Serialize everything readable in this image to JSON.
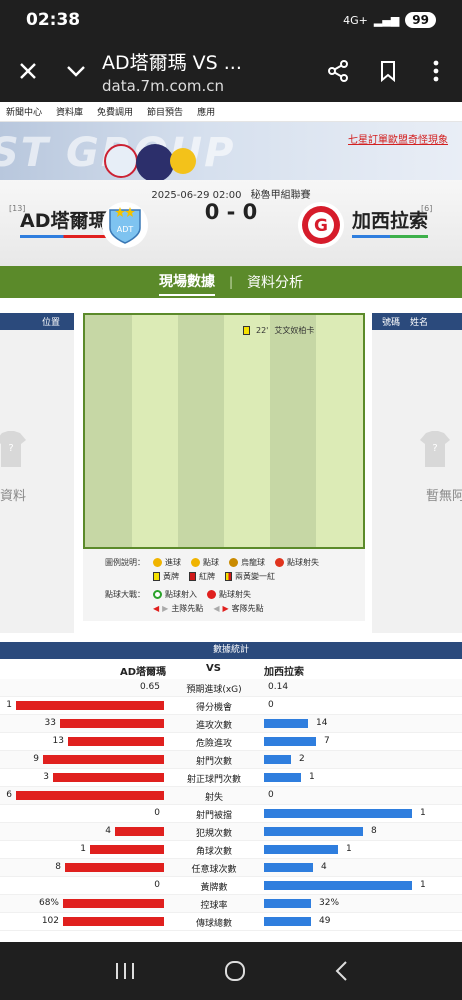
{
  "status_bar": {
    "time": "02:38",
    "network": "4G+",
    "battery": "99"
  },
  "browser": {
    "title": "AD塔爾瑪 VS ...",
    "url": "data.7m.com.cn"
  },
  "site_nav": [
    "新聞中心",
    "資料庫",
    "免費調用",
    "節目預告",
    "應用"
  ],
  "banner": {
    "text": "ST GROUP",
    "link": "七星訂單歐盟奇怪現象"
  },
  "match": {
    "datetime": "2025-06-29 02:00",
    "league": "秘魯甲組聯賽",
    "score": "0 - 0",
    "home": {
      "name": "AD塔爾瑪",
      "rank": "[13]"
    },
    "away": {
      "name": "加西拉索",
      "rank": "[6]"
    }
  },
  "tabs": [
    "現場數據",
    "資料分析"
  ],
  "side": {
    "left_header": "位置",
    "right_header_no": "號碼",
    "right_header_name": "姓名",
    "left_nodata": "資料",
    "right_nodata": "暫無阿"
  },
  "pitch_event": {
    "minute": "22'",
    "player": "艾文奴柏卡"
  },
  "legend": {
    "label": "圖例說明：",
    "items": [
      "進球",
      "點球",
      "烏龍球",
      "點球射失"
    ],
    "cards": [
      "黃牌",
      "紅牌",
      "兩黃變一紅"
    ],
    "shootout_label": "點球大戰：",
    "shootout": [
      "點球射入",
      "點球射失"
    ],
    "arrows": [
      "主隊先點",
      "客隊先點"
    ]
  },
  "stats": {
    "title": "數據統計",
    "home": "AD塔爾瑪",
    "vs": "VS",
    "away": "加西拉索",
    "rows": [
      {
        "label": "預期進球(xG)",
        "home": "0.65",
        "away": "0.14",
        "hf": 0,
        "af": 0
      },
      {
        "label": "得分機會",
        "home": "1",
        "away": "0",
        "hf": 1,
        "af": 0
      },
      {
        "label": "進攻次數",
        "home": "33",
        "away": "14",
        "hf": 0.7,
        "af": 0.3
      },
      {
        "label": "危險進攻",
        "home": "13",
        "away": "7",
        "hf": 0.65,
        "af": 0.35
      },
      {
        "label": "射門次數",
        "home": "9",
        "away": "2",
        "hf": 0.82,
        "af": 0.18
      },
      {
        "label": "射正球門次數",
        "home": "3",
        "away": "1",
        "hf": 0.75,
        "af": 0.25
      },
      {
        "label": "射失",
        "home": "6",
        "away": "0",
        "hf": 1,
        "af": 0
      },
      {
        "label": "射門被擋",
        "home": "0",
        "away": "1",
        "hf": 0,
        "af": 1
      },
      {
        "label": "犯規次數",
        "home": "4",
        "away": "8",
        "hf": 0.33,
        "af": 0.67
      },
      {
        "label": "角球次數",
        "home": "1",
        "away": "1",
        "hf": 0.5,
        "af": 0.5
      },
      {
        "label": "任意球次數",
        "home": "8",
        "away": "4",
        "hf": 0.67,
        "af": 0.33
      },
      {
        "label": "黃牌數",
        "home": "0",
        "away": "1",
        "hf": 0,
        "af": 1
      },
      {
        "label": "控球率",
        "home": "68%",
        "away": "32%",
        "hf": 0.68,
        "af": 0.32
      },
      {
        "label": "傳球總數",
        "home": "102",
        "away": "49",
        "hf": 0.68,
        "af": 0.32
      }
    ]
  }
}
